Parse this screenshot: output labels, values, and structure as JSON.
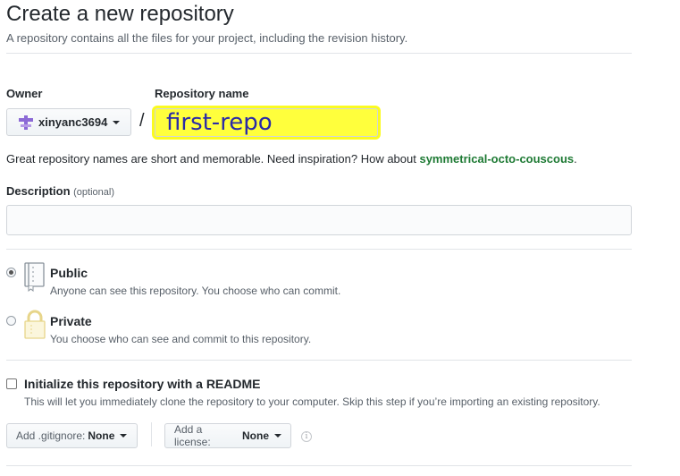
{
  "header": {
    "title": "Create a new repository",
    "subtitle": "A repository contains all the files for your project, including the revision history."
  },
  "owner": {
    "label": "Owner",
    "value": "xinyanc3694"
  },
  "repo": {
    "label": "Repository name",
    "value": "first-repo",
    "highlight_color": "#ffff3c"
  },
  "hint": {
    "text": "Great repository names are short and memorable. Need inspiration? How about ",
    "suggestion": "symmetrical-octo-couscous",
    "end": "."
  },
  "description": {
    "label": "Description",
    "optional": "(optional)",
    "value": ""
  },
  "visibility": {
    "public": {
      "title": "Public",
      "note": "Anyone can see this repository. You choose who can commit.",
      "selected": true,
      "icon": "repo-book-icon"
    },
    "private": {
      "title": "Private",
      "note": "You choose who can see and commit to this repository.",
      "selected": false,
      "icon": "lock-icon"
    }
  },
  "readme": {
    "title": "Initialize this repository with a README",
    "note": "This will let you immediately clone the repository to your computer. Skip this step if you’re importing an existing repository.",
    "checked": false
  },
  "gitignore": {
    "label": "Add .gitignore:",
    "value": "None"
  },
  "license": {
    "label": "Add a license:",
    "value": "None"
  },
  "colors": {
    "suggestion": "#1e7a34",
    "lock_icon": "#e7d58a"
  }
}
